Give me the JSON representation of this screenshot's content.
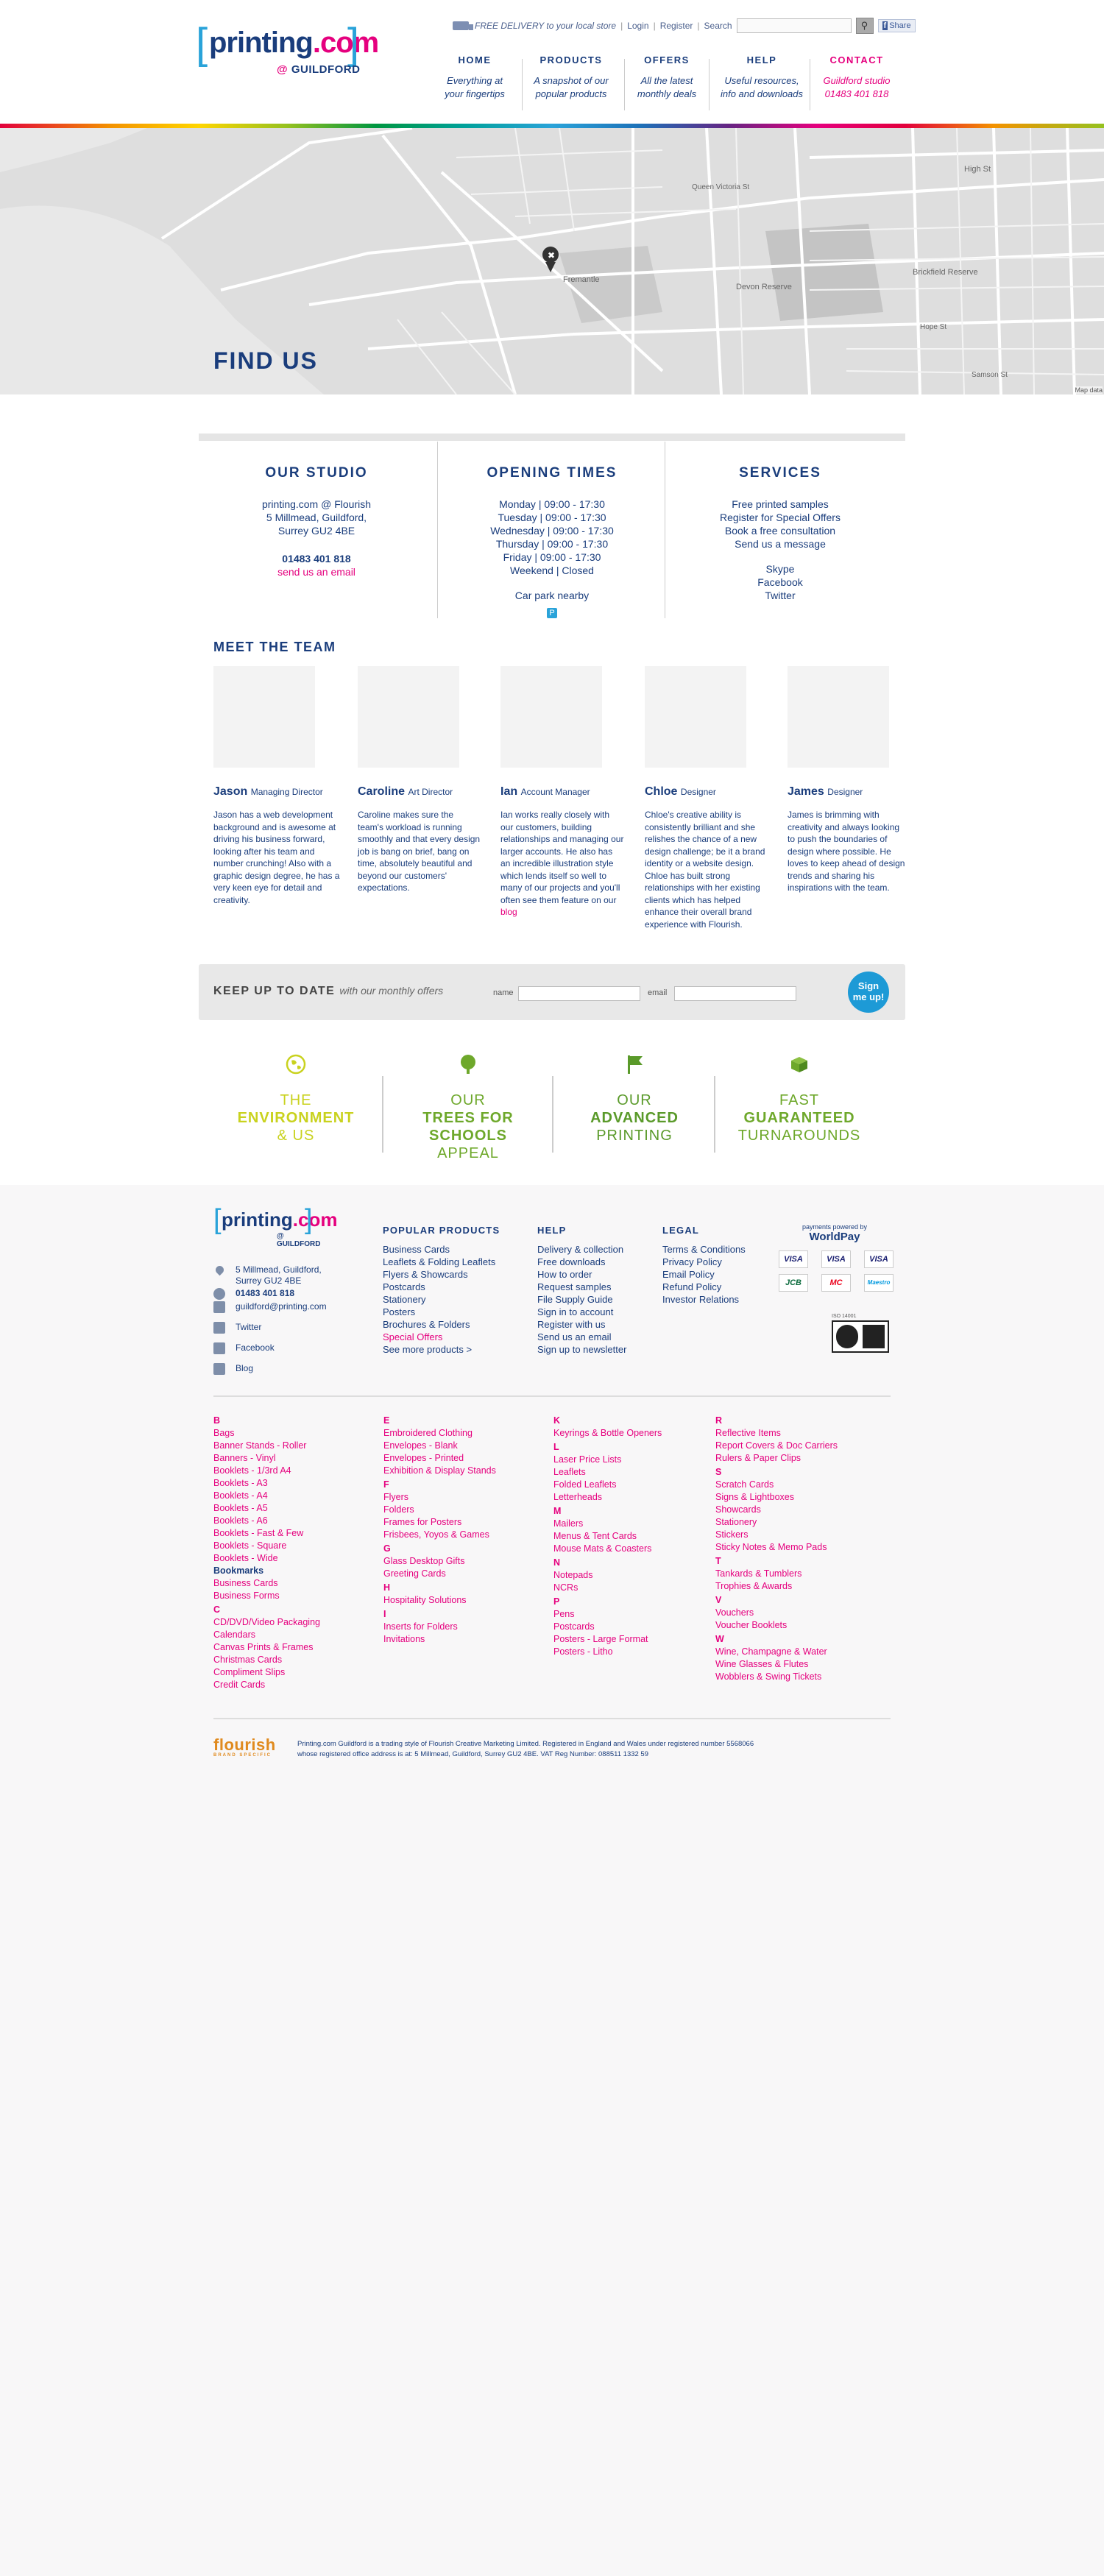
{
  "header": {
    "logo": {
      "word": "printing",
      "com": ".com",
      "sub_at": "@",
      "sub": "GUILDFORD"
    },
    "topbar": {
      "delivery": "FREE DELIVERY to your local store",
      "login": "Login",
      "register": "Register",
      "search_label": "Search",
      "search_placeholder": "",
      "share": "Share"
    },
    "nav": [
      {
        "title": "HOME",
        "desc1": "Everything at",
        "desc2": "your fingertips"
      },
      {
        "title": "PRODUCTS",
        "desc1": "A snapshot of our",
        "desc2": "popular products"
      },
      {
        "title": "OFFERS",
        "desc1": "All the latest",
        "desc2": "monthly deals"
      },
      {
        "title": "HELP",
        "desc1": "Useful resources,",
        "desc2": "info and downloads"
      },
      {
        "title": "CONTACT",
        "desc1": "Guildford studio",
        "desc2": "01483 401 818"
      }
    ]
  },
  "map": {
    "title": "FIND US",
    "attribution": "Map data",
    "street_labels": [
      "Fremantle",
      "High St",
      "Queen Victoria St",
      "Brickfield Reserve",
      "Devon Reserve",
      "Hope St",
      "Samson St"
    ]
  },
  "studio": {
    "heading": "OUR STUDIO",
    "lines": [
      "printing.com @ Flourish",
      "5 Millmead, Guildford,",
      "Surrey GU2 4BE"
    ],
    "phone": "01483 401 818",
    "email": "send us an email"
  },
  "hours": {
    "heading": "OPENING TIMES",
    "lines": [
      "Monday  |  09:00 - 17:30",
      "Tuesday  |  09:00 - 17:30",
      "Wednesday  |  09:00 - 17:30",
      "Thursday  |  09:00 - 17:30",
      "Friday  |  09:00 - 17:30",
      "Weekend  |  Closed"
    ],
    "car_park": "Car park nearby",
    "car_park_icon": "P"
  },
  "services": {
    "heading": "SERVICES",
    "links": [
      "Free printed samples",
      "Register for Special Offers",
      "Book a free consultation",
      "Send us a message"
    ],
    "social": [
      "Skype",
      "Facebook",
      "Twitter"
    ]
  },
  "team": {
    "heading": "MEET THE TEAM",
    "members": [
      {
        "name": "Jason",
        "role": "Managing Director",
        "bio": "Jason has a web development background and is awesome at driving his business forward, looking after his team and number crunching! Also with a graphic design degree, he has a very keen eye for detail and creativity."
      },
      {
        "name": "Caroline",
        "role": "Art Director",
        "bio": "Caroline makes sure the team's workload is running smoothly and that every design job is bang on brief, bang on time, absolutely beautiful and beyond our customers' expectations."
      },
      {
        "name": "Ian",
        "role": "Account Manager",
        "bio": "Ian works really closely with our customers, building relationships and managing our larger accounts. He also has an incredible illustration style which lends itself so well to many of our projects and you'll often see them feature on our",
        "link": "blog"
      },
      {
        "name": "Chloe",
        "role": "Designer",
        "bio": "Chloe's creative ability is consistently brilliant and she relishes the chance of a new design challenge; be it a brand identity or a website design. Chloe has built strong relationships with her existing clients which has helped enhance their overall brand experience with Flourish."
      },
      {
        "name": "James",
        "role": "Designer",
        "bio": "James is brimming with creativity and always looking to push the boundaries of design where possible. He loves to keep ahead of design trends and sharing his inspirations with the team."
      }
    ]
  },
  "newsletter": {
    "heading": "KEEP UP TO DATE",
    "sub": "with our monthly offers",
    "name_label": "name",
    "email_label": "email",
    "button1": "Sign",
    "button2": "me up!"
  },
  "features": [
    {
      "l1": "THE",
      "l2": "ENVIRONMENT",
      "l3": "& US",
      "color": "#c9d21e",
      "icon": "globe-icon"
    },
    {
      "l1": "OUR",
      "l2": "TREES FOR",
      "l2b": "SCHOOLS",
      "l3": "APPEAL",
      "color": "#6ea82b",
      "icon": "tree-icon"
    },
    {
      "l1": "OUR",
      "l2": "ADVANCED",
      "l3": "PRINTING",
      "color": "#5a9a2a",
      "icon": "flag-icon"
    },
    {
      "l1": "FAST",
      "l2": "GUARANTEED",
      "l3": "TURNAROUNDS",
      "color": "#6ea82b",
      "icon": "box-icon"
    }
  ],
  "footer": {
    "logo": {
      "word": "printing",
      "com": ".com",
      "sub": "@ GUILDFORD"
    },
    "contact": {
      "address1": "5 Millmead, Guildford,",
      "address2": "Surrey GU2 4BE",
      "phone": "01483 401 818",
      "email": "guildford@printing.com",
      "twitter": "Twitter",
      "facebook": "Facebook",
      "blog": "Blog"
    },
    "popular": {
      "heading": "POPULAR PRODUCTS",
      "items": [
        "Business Cards",
        "Leaflets & Folding Leaflets",
        "Flyers & Showcards",
        "Postcards",
        "Stationery",
        "Posters",
        "Brochures & Folders"
      ],
      "special": "Special Offers",
      "more": "See more products >"
    },
    "help": {
      "heading": "HELP",
      "items": [
        "Delivery & collection",
        "Free downloads",
        "How to order",
        "Request samples",
        "File Supply Guide",
        "Sign in to account",
        "Register with us",
        "Send us an email",
        "Sign up to newsletter"
      ]
    },
    "legal": {
      "heading": "LEGAL",
      "items": [
        "Terms & Conditions",
        "Privacy Policy",
        "Email Policy",
        "Refund Policy",
        "Investor Relations"
      ]
    },
    "payments": {
      "label": "payments powered by",
      "brand": "WorldPay",
      "cards": [
        "VISA",
        "VISA",
        "VISA",
        "JCB",
        "MC",
        "Maestro"
      ],
      "iso": "ISO 14001"
    },
    "az": [
      [
        {
          "t": "B",
          "k": "letter"
        },
        {
          "t": "Bags"
        },
        {
          "t": "Banner Stands - Roller"
        },
        {
          "t": "Banners - Vinyl"
        },
        {
          "t": "Booklets - 1/3rd A4"
        },
        {
          "t": "Booklets - A3"
        },
        {
          "t": "Booklets - A4"
        },
        {
          "t": "Booklets - A5"
        },
        {
          "t": "Booklets - A6"
        },
        {
          "t": "Booklets - Fast & Few"
        },
        {
          "t": "Booklets - Square"
        },
        {
          "t": "Booklets - Wide"
        },
        {
          "t": "Bookmarks",
          "k": "bold"
        },
        {
          "t": "Business Cards"
        },
        {
          "t": "Business Forms"
        },
        {
          "t": "C",
          "k": "letter"
        },
        {
          "t": "CD/DVD/Video Packaging"
        },
        {
          "t": "Calendars"
        },
        {
          "t": "Canvas Prints & Frames"
        },
        {
          "t": "Christmas Cards"
        },
        {
          "t": "Compliment Slips"
        },
        {
          "t": "Credit Cards"
        }
      ],
      [
        {
          "t": "E",
          "k": "letter"
        },
        {
          "t": "Embroidered Clothing"
        },
        {
          "t": "Envelopes - Blank"
        },
        {
          "t": "Envelopes - Printed"
        },
        {
          "t": "Exhibition & Display Stands"
        },
        {
          "t": "F",
          "k": "letter"
        },
        {
          "t": "Flyers"
        },
        {
          "t": "Folders"
        },
        {
          "t": "Frames for Posters"
        },
        {
          "t": "Frisbees, Yoyos & Games"
        },
        {
          "t": "G",
          "k": "letter"
        },
        {
          "t": "Glass Desktop Gifts"
        },
        {
          "t": "Greeting Cards"
        },
        {
          "t": "H",
          "k": "letter"
        },
        {
          "t": "Hospitality Solutions"
        },
        {
          "t": "I",
          "k": "letter"
        },
        {
          "t": "Inserts for Folders"
        },
        {
          "t": "Invitations"
        }
      ],
      [
        {
          "t": "K",
          "k": "letter"
        },
        {
          "t": "Keyrings & Bottle Openers"
        },
        {
          "t": "L",
          "k": "letter"
        },
        {
          "t": "Laser Price Lists"
        },
        {
          "t": "Leaflets"
        },
        {
          "t": "Folded Leaflets"
        },
        {
          "t": "Letterheads"
        },
        {
          "t": "M",
          "k": "letter"
        },
        {
          "t": "Mailers"
        },
        {
          "t": "Menus & Tent Cards"
        },
        {
          "t": "Mouse Mats & Coasters"
        },
        {
          "t": "N",
          "k": "letter"
        },
        {
          "t": "Notepads"
        },
        {
          "t": "NCRs"
        },
        {
          "t": "P",
          "k": "letter"
        },
        {
          "t": "Pens"
        },
        {
          "t": "Postcards"
        },
        {
          "t": "Posters - Large Format"
        },
        {
          "t": "Posters - Litho"
        }
      ],
      [
        {
          "t": "R",
          "k": "letter"
        },
        {
          "t": "Reflective Items"
        },
        {
          "t": "Report Covers & Doc Carriers"
        },
        {
          "t": "Rulers & Paper Clips"
        },
        {
          "t": "S",
          "k": "letter"
        },
        {
          "t": "Scratch Cards"
        },
        {
          "t": "Signs & Lightboxes"
        },
        {
          "t": "Showcards"
        },
        {
          "t": "Stationery"
        },
        {
          "t": "Stickers"
        },
        {
          "t": "Sticky Notes & Memo Pads"
        },
        {
          "t": "T",
          "k": "letter"
        },
        {
          "t": "Tankards & Tumblers"
        },
        {
          "t": "Trophies & Awards"
        },
        {
          "t": "V",
          "k": "letter"
        },
        {
          "t": "Vouchers"
        },
        {
          "t": "Voucher Booklets"
        },
        {
          "t": "W",
          "k": "letter"
        },
        {
          "t": "Wine, Champagne & Water"
        },
        {
          "t": "Wine Glasses & Flutes"
        },
        {
          "t": "Wobblers & Swing Tickets"
        }
      ]
    ],
    "flourish": {
      "name": "flourish",
      "tag": "BRAND SPECIFIC"
    },
    "legal_text1": "Printing.com Guildford is a trading style of Flourish Creative Marketing Limited. Registered in England and Wales under registered number 5568066",
    "legal_text2": "whose registered office address is at: 5 Millmead, Guildford, Surrey GU2 4BE. VAT Reg Number: 088511 1332 59"
  }
}
